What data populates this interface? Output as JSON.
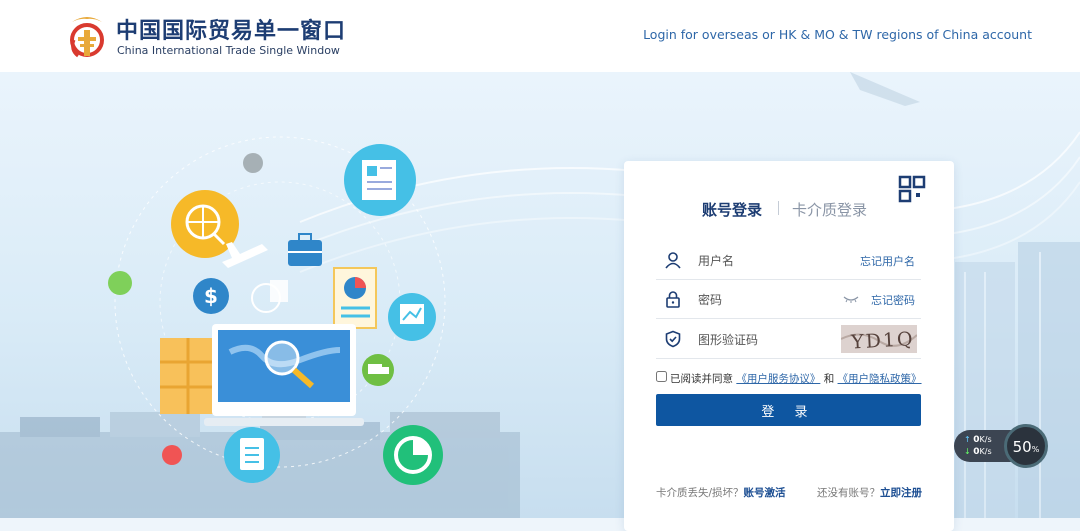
{
  "header": {
    "brand_cn": "中国国际贸易单一窗口",
    "brand_en": "China International Trade Single Window",
    "overseas_link": "Login for overseas or HK & MO & TW regions of China account"
  },
  "login": {
    "tabs": [
      {
        "label": "账号登录",
        "active": true
      },
      {
        "label": "卡介质登录",
        "active": false
      }
    ],
    "username_placeholder": "用户名",
    "forgot_username": "忘记用户名",
    "password_placeholder": "密码",
    "forgot_password": "忘记密码",
    "captcha_placeholder": "图形验证码",
    "captcha_text": "YD1Q",
    "agree_prefix": "已阅读并同意",
    "agree_service": "《用户服务协议》",
    "agree_and": "和",
    "agree_privacy": "《用户隐私政策》",
    "login_button": "登 录",
    "card_lost_text": "卡介质丢失/损坏？",
    "card_activate": "账号激活",
    "no_account_text": "还没有账号？",
    "register": "立即注册"
  },
  "network_widget": {
    "upload": "0",
    "download": "0",
    "unit": "K/s",
    "percent": "50",
    "percent_sign": "%"
  },
  "colors": {
    "brand_navy": "#1d3d73",
    "link_blue": "#2e67a8",
    "button_blue": "#0e56a1"
  }
}
